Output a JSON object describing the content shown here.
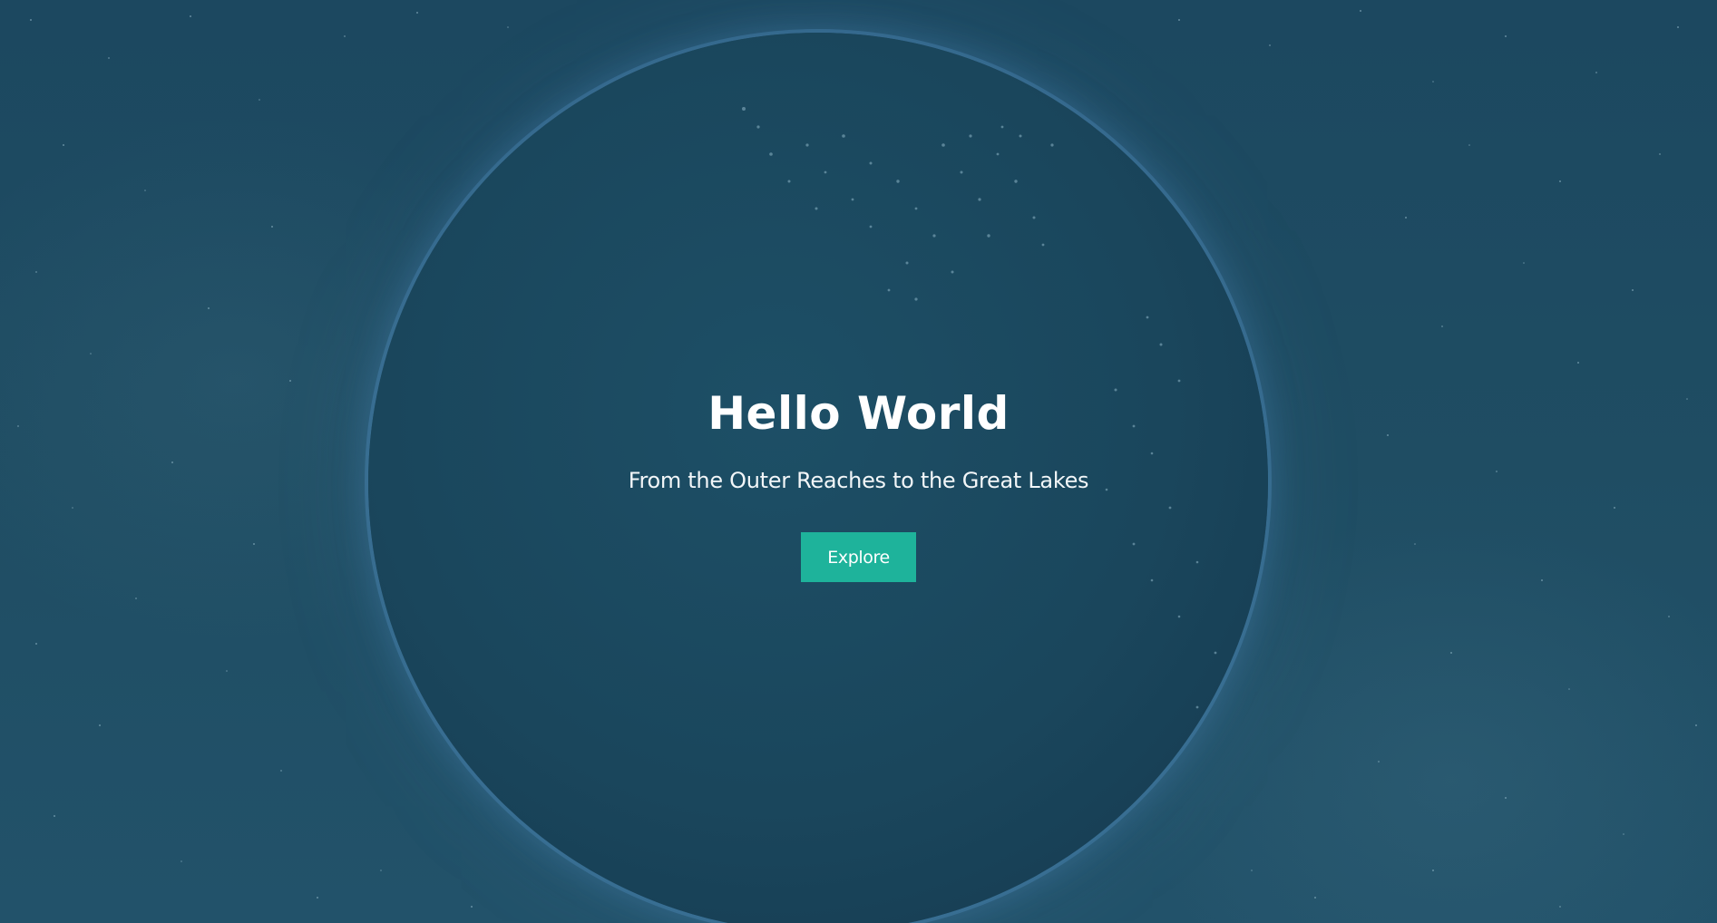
{
  "hero": {
    "title": "Hello World",
    "subtitle": "From the Outer Reaches to the Great Lakes",
    "button_label": "Explore"
  },
  "colors": {
    "background": "#1f4a60",
    "planet": "#1a465c",
    "button": "#1eb39b",
    "text": "#ffffff"
  },
  "icons": {
    "background_image": "space-earth-night-image"
  }
}
